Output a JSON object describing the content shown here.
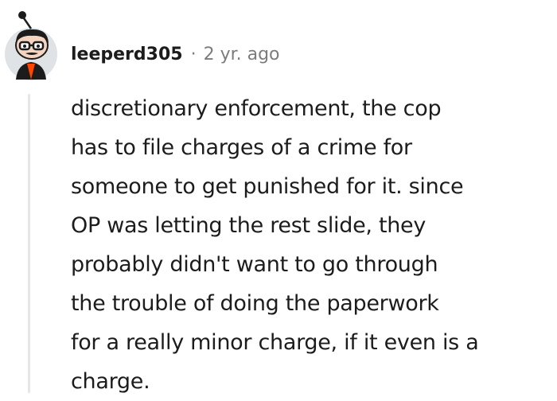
{
  "comment": {
    "author": "leeperd305",
    "separator": "·",
    "age": "2 yr. ago",
    "avatar_icon": "snoo-avatar-icon",
    "body_lines": [
      "discretionary enforcement, the cop",
      "has to file charges of a crime for",
      "someone to get punished for it. since",
      "OP was letting the rest slide, they",
      "probably didn't want to go through",
      "the trouble of doing the paperwork",
      "for a really minor charge, if it even is a",
      "charge."
    ]
  },
  "colors": {
    "text": "#1c1c1c",
    "meta": "#7c7c7c",
    "thread_line": "#e4e6e8",
    "avatar_bg": "#dfe3e6",
    "avatar_shirt": "#ff4500"
  }
}
